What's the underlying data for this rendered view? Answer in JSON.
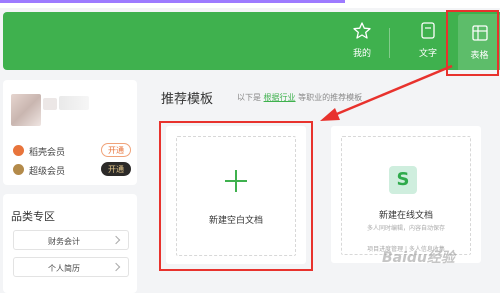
{
  "header": {
    "buttons": [
      {
        "label": "我的",
        "icon": "star-icon"
      },
      {
        "label": "文字",
        "icon": "document-icon"
      },
      {
        "label": "表格",
        "icon": "table-icon"
      }
    ],
    "color": "#3fb14e"
  },
  "user": {
    "vip": [
      {
        "label": "稻壳会员",
        "action": "开通"
      },
      {
        "label": "超级会员",
        "action": "开通"
      }
    ]
  },
  "categories": {
    "title": "品类专区",
    "items": [
      "财务会计",
      "个人简历"
    ]
  },
  "templates": {
    "title": "推荐模板",
    "subtitle_prefix": "以下是",
    "subtitle_link": "根据行业",
    "subtitle_suffix": "等职业的推荐模板",
    "blank": {
      "label": "新建空白文档"
    },
    "online": {
      "label": "新建在线文档",
      "desc1": "多人同时编辑，内容自动保存",
      "desc2": "项目进度管理 | 多人信息收集"
    }
  },
  "watermark": "Baidu经验"
}
